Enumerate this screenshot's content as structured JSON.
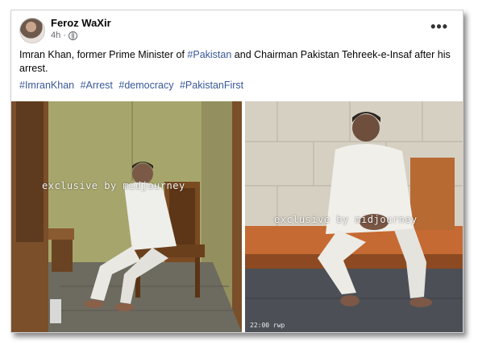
{
  "post": {
    "author": "Feroz WaXir",
    "time": "4h",
    "more_label": "•••",
    "text_before": "Imran Khan, former Prime Minister of ",
    "text_link": "#Pakistan",
    "text_after": " and Chairman Pakistan Tehreek-e-Insaf after his arrest.",
    "hashtags": [
      "#ImranKhan",
      "#Arrest",
      "#democracy",
      "#PakistanFirst"
    ]
  },
  "photos": [
    {
      "watermark": "exclusive  by midjourney"
    },
    {
      "watermark": "exclusive  by midjourney",
      "timestamp": "22:00 rwp"
    }
  ],
  "icons": {
    "privacy": "globe-icon",
    "more": "more-options-icon"
  },
  "colors": {
    "link": "#385898",
    "meta": "#65676b"
  }
}
